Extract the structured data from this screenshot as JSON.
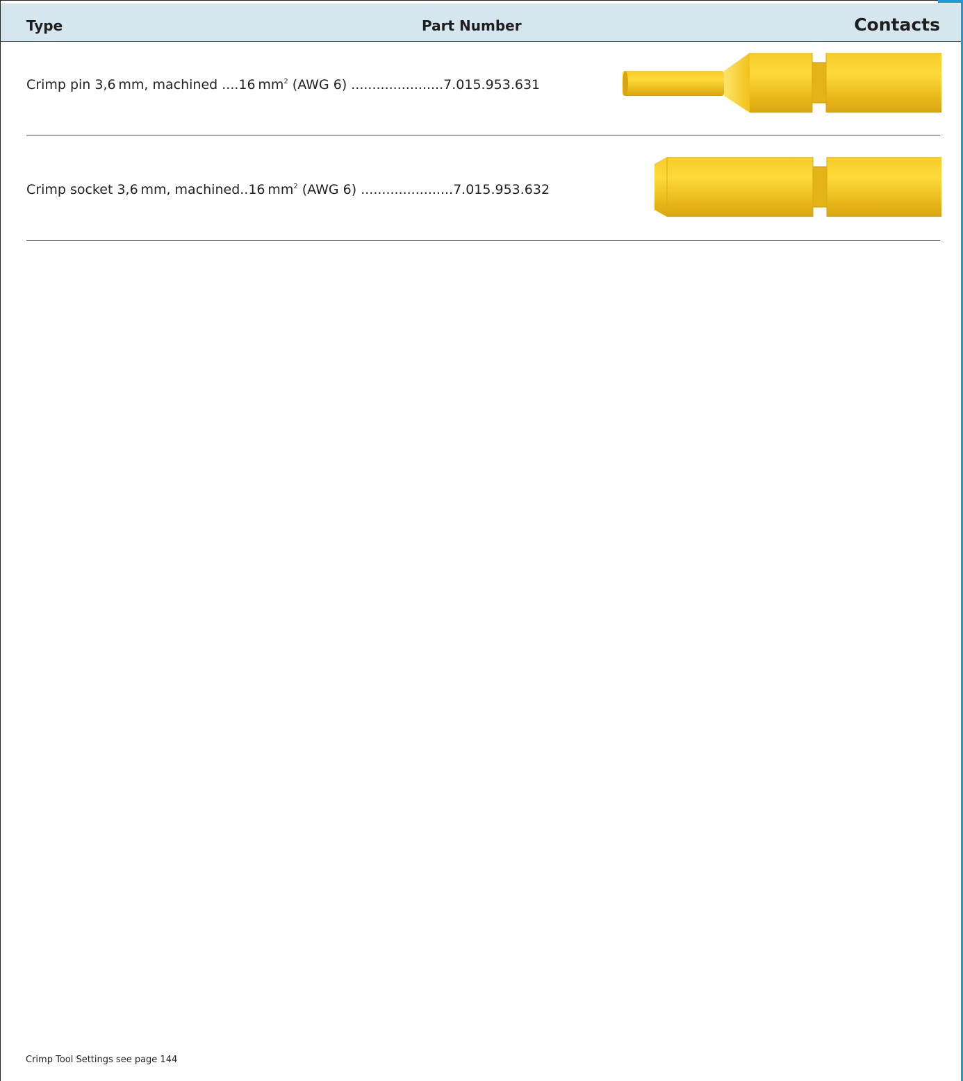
{
  "header": {
    "type_label": "Type",
    "part_number_label": "Part Number",
    "contacts_label": "Contacts"
  },
  "rows": [
    {
      "description": "Crimp pin 3,6 mm, machined ....16 mm",
      "superscript": "2",
      "suffix": " (AWG 6) ......................7.015.953.631",
      "image_icon": "crimp-pin-image"
    },
    {
      "description": "Crimp socket 3,6 mm, machined..16 mm",
      "superscript": "2",
      "suffix": " (AWG 6) ......................7.015.953.632",
      "image_icon": "crimp-socket-image"
    }
  ],
  "footer": {
    "note": "Crimp Tool Settings see page 144"
  },
  "colors": {
    "header_bg": "#d6e6ef",
    "accent": "#1b9ad6",
    "contact_gold": "#f2c21a"
  }
}
